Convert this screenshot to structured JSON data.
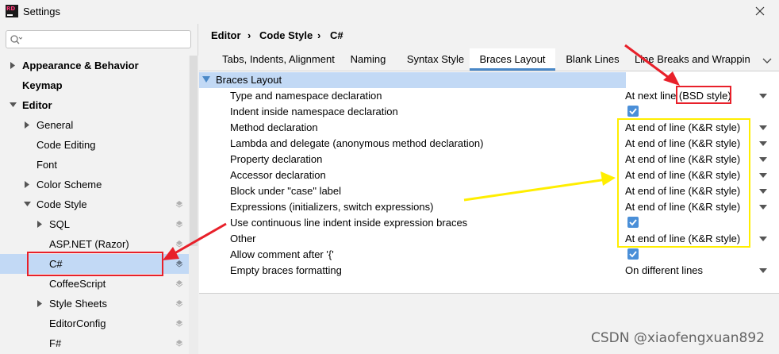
{
  "window": {
    "title": "Settings",
    "logo_text": "RD"
  },
  "search": {
    "placeholder": "",
    "icon": "search-icon"
  },
  "tree": [
    {
      "label": "Appearance & Behavior",
      "bold": true,
      "expanded": false,
      "has_arrow": true
    },
    {
      "label": "Keymap",
      "bold": true,
      "has_arrow": false
    },
    {
      "label": "Editor",
      "bold": true,
      "expanded": true,
      "has_arrow": true
    },
    {
      "label": "General",
      "has_arrow": true,
      "expanded": false
    },
    {
      "label": "Code Editing",
      "has_arrow": false
    },
    {
      "label": "Font",
      "has_arrow": false
    },
    {
      "label": "Color Scheme",
      "has_arrow": true,
      "expanded": false
    },
    {
      "label": "Code Style",
      "has_arrow": true,
      "expanded": true,
      "icon": true
    },
    {
      "label": "SQL",
      "has_arrow": true,
      "expanded": false,
      "icon": true
    },
    {
      "label": "ASP.NET (Razor)",
      "has_arrow": false,
      "icon": true
    },
    {
      "label": "C#",
      "has_arrow": false,
      "icon": true,
      "selected": true
    },
    {
      "label": "CoffeeScript",
      "has_arrow": false,
      "icon": true
    },
    {
      "label": "Style Sheets",
      "has_arrow": true,
      "expanded": false,
      "icon": true
    },
    {
      "label": "EditorConfig",
      "has_arrow": false,
      "icon": true
    },
    {
      "label": "F#",
      "has_arrow": false,
      "icon": true
    }
  ],
  "breadcrumb": {
    "part1": "Editor",
    "sep": "›",
    "part2": "Code Style",
    "part3": "C#"
  },
  "tabs": [
    {
      "label": "Tabs, Indents, Alignment"
    },
    {
      "label": "Naming"
    },
    {
      "label": "Syntax Style"
    },
    {
      "label": "Braces Layout",
      "active": true
    },
    {
      "label": "Blank Lines"
    },
    {
      "label": "Line Breaks and Wrapping"
    }
  ],
  "section": {
    "title": "Braces Layout"
  },
  "options": [
    {
      "label": "Type and namespace declaration",
      "type": "select",
      "value": "At next line (BSD style)"
    },
    {
      "label": "Indent inside namespace declaration",
      "type": "check",
      "checked": true
    },
    {
      "label": "Method declaration",
      "type": "select",
      "value": "At end of line (K&R style)"
    },
    {
      "label": "Lambda and delegate (anonymous method declaration)",
      "type": "select",
      "value": "At end of line (K&R style)"
    },
    {
      "label": "Property declaration",
      "type": "select",
      "value": "At end of line (K&R style)"
    },
    {
      "label": "Accessor declaration",
      "type": "select",
      "value": "At end of line (K&R style)"
    },
    {
      "label": "Block under \"case\" label",
      "type": "select",
      "value": "At end of line (K&R style)"
    },
    {
      "label": "Expressions (initializers, switch expressions)",
      "type": "select",
      "value": "At end of line (K&R style)"
    },
    {
      "label": "Use continuous line indent inside expression braces",
      "type": "check",
      "checked": true
    },
    {
      "label": "Other",
      "type": "select",
      "value": "At end of line (K&R style)"
    },
    {
      "label": "Allow comment after '{'",
      "type": "check",
      "checked": true
    },
    {
      "label": "Empty braces formatting",
      "type": "select",
      "value": "On different lines"
    }
  ],
  "watermark": "CSDN @xiaofengxuan892",
  "colors": {
    "accent": "#4a88c7",
    "selection": "#c2d9f5",
    "annotation_red": "#e8202a",
    "annotation_yellow": "#ffee00"
  }
}
